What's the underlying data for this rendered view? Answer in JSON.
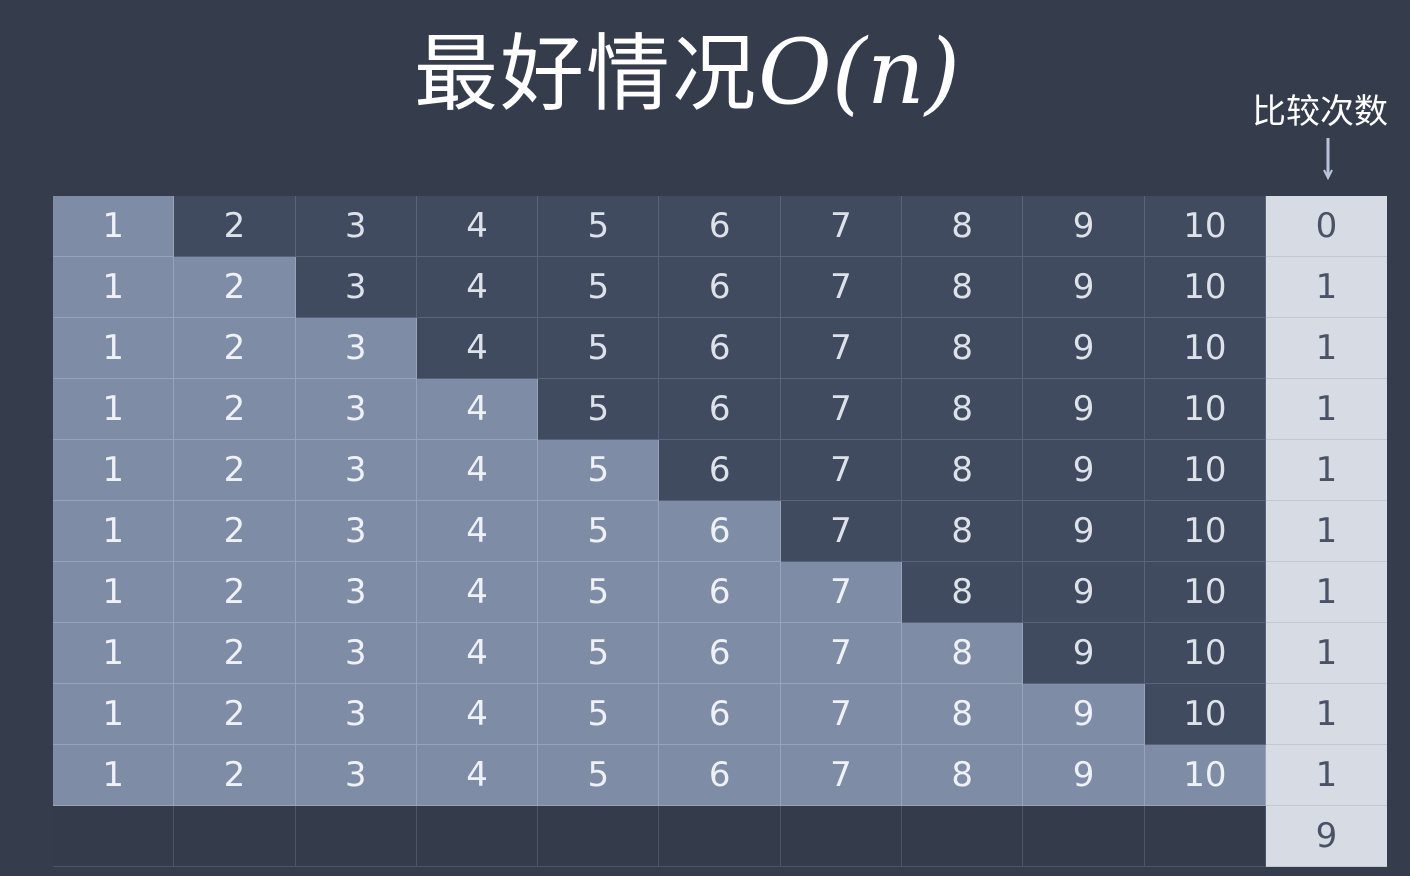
{
  "title": {
    "text": "最好情况",
    "complexity": "O(n)"
  },
  "side_label": "比较次数",
  "table": {
    "rows": [
      {
        "values": [
          "1",
          "2",
          "3",
          "4",
          "5",
          "6",
          "7",
          "8",
          "9",
          "10"
        ],
        "sorted_count": 1,
        "count": "0"
      },
      {
        "values": [
          "1",
          "2",
          "3",
          "4",
          "5",
          "6",
          "7",
          "8",
          "9",
          "10"
        ],
        "sorted_count": 2,
        "count": "1"
      },
      {
        "values": [
          "1",
          "2",
          "3",
          "4",
          "5",
          "6",
          "7",
          "8",
          "9",
          "10"
        ],
        "sorted_count": 3,
        "count": "1"
      },
      {
        "values": [
          "1",
          "2",
          "3",
          "4",
          "5",
          "6",
          "7",
          "8",
          "9",
          "10"
        ],
        "sorted_count": 4,
        "count": "1"
      },
      {
        "values": [
          "1",
          "2",
          "3",
          "4",
          "5",
          "6",
          "7",
          "8",
          "9",
          "10"
        ],
        "sorted_count": 5,
        "count": "1"
      },
      {
        "values": [
          "1",
          "2",
          "3",
          "4",
          "5",
          "6",
          "7",
          "8",
          "9",
          "10"
        ],
        "sorted_count": 6,
        "count": "1"
      },
      {
        "values": [
          "1",
          "2",
          "3",
          "4",
          "5",
          "6",
          "7",
          "8",
          "9",
          "10"
        ],
        "sorted_count": 7,
        "count": "1"
      },
      {
        "values": [
          "1",
          "2",
          "3",
          "4",
          "5",
          "6",
          "7",
          "8",
          "9",
          "10"
        ],
        "sorted_count": 8,
        "count": "1"
      },
      {
        "values": [
          "1",
          "2",
          "3",
          "4",
          "5",
          "6",
          "7",
          "8",
          "9",
          "10"
        ],
        "sorted_count": 9,
        "count": "1"
      },
      {
        "values": [
          "1",
          "2",
          "3",
          "4",
          "5",
          "6",
          "7",
          "8",
          "9",
          "10"
        ],
        "sorted_count": 10,
        "count": "1"
      }
    ],
    "total": "9"
  },
  "colors": {
    "background": "#353c4c",
    "sorted_cell": "#7f8ca6",
    "unsorted_cell": "#414b5f",
    "count_column": "#d7dbe3"
  }
}
